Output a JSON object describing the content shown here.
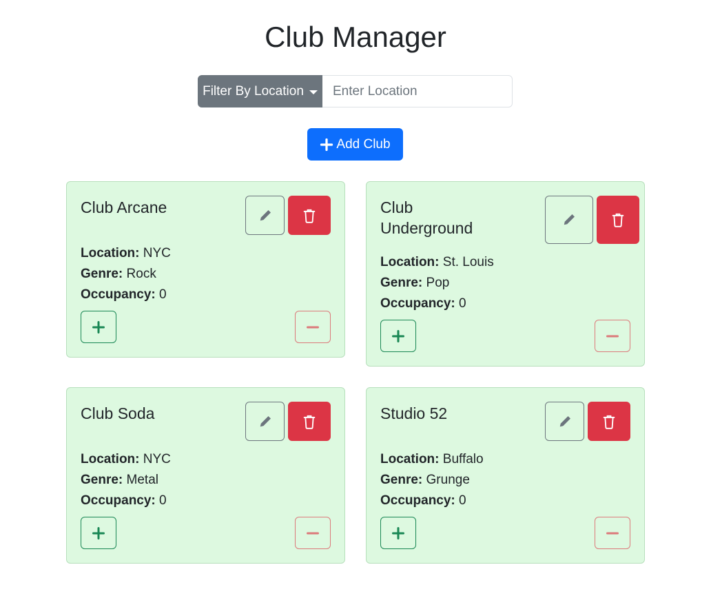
{
  "header": {
    "title": "Club Manager"
  },
  "filter": {
    "button_label": "Filter By Location",
    "input_placeholder": "Enter Location",
    "input_value": ""
  },
  "add_button": {
    "label": "Add Club",
    "icon": "plus-icon"
  },
  "labels": {
    "location": "Location:",
    "genre": "Genre:",
    "occupancy": "Occupancy:"
  },
  "clubs": [
    {
      "name": "Club Arcane",
      "location": "NYC",
      "genre": "Rock",
      "occupancy": "0"
    },
    {
      "name": "Club Underground",
      "location": "St. Louis",
      "genre": "Pop",
      "occupancy": "0"
    },
    {
      "name": "Club Soda",
      "location": "NYC",
      "genre": "Metal",
      "occupancy": "0"
    },
    {
      "name": "Studio 52",
      "location": "Buffalo",
      "genre": "Grunge",
      "occupancy": "0"
    }
  ],
  "colors": {
    "card_bg": "#ddf9e0",
    "card_border": "#b7dfbc",
    "primary": "#0d6efd",
    "secondary": "#6c757d",
    "danger": "#dc3545",
    "success": "#198754"
  },
  "icons": {
    "edit": "pencil-icon",
    "delete": "trash-icon",
    "increment": "plus-icon",
    "decrement": "minus-icon"
  }
}
